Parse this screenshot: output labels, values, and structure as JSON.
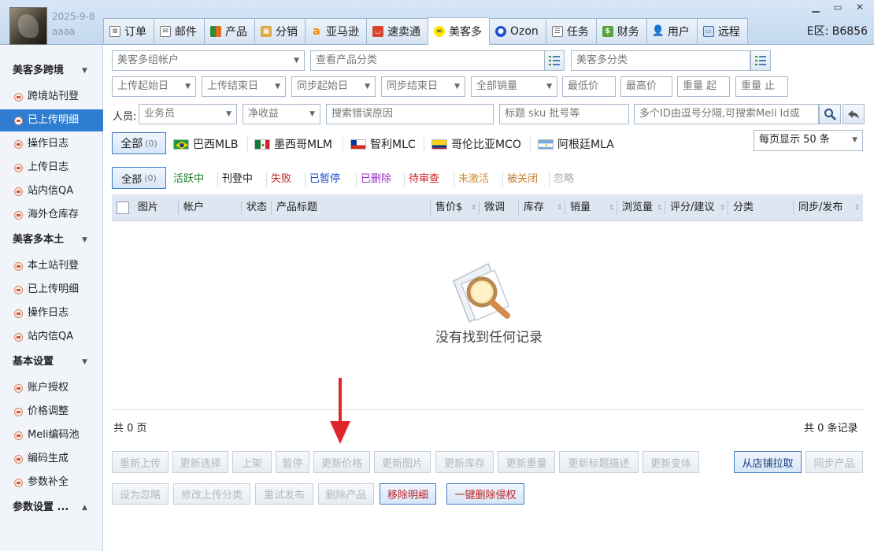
{
  "user": {
    "date": "2025-9-8",
    "name": "aaaa"
  },
  "tabs": [
    {
      "label": "订单",
      "icon": "order-icon"
    },
    {
      "label": "邮件",
      "icon": "mail-icon"
    },
    {
      "label": "产品",
      "icon": "product-icon"
    },
    {
      "label": "分销",
      "icon": "distribution-icon"
    },
    {
      "label": "亚马逊",
      "icon": "amazon-icon"
    },
    {
      "label": "速卖通",
      "icon": "aliexpress-icon"
    },
    {
      "label": "美客多",
      "icon": "mercadolibre-icon",
      "active": true
    },
    {
      "label": "Ozon",
      "icon": "ozon-icon"
    },
    {
      "label": "任务",
      "icon": "task-icon"
    },
    {
      "label": "财务",
      "icon": "finance-icon"
    },
    {
      "label": "用户",
      "icon": "user-icon"
    },
    {
      "label": "远程",
      "icon": "remote-icon"
    }
  ],
  "region": "E区: B6856",
  "sidebar": {
    "groups": [
      {
        "label": "美客多跨境",
        "items": [
          "跨境站刊登",
          "已上传明细",
          "操作日志",
          "上传日志",
          "站内信QA",
          "海外仓库存"
        ]
      },
      {
        "label": "美客多本土",
        "items": [
          "本土站刊登",
          "已上传明细",
          "操作日志",
          "站内信QA"
        ]
      },
      {
        "label": "基本设置",
        "items": [
          "账户授权",
          "价格调整",
          "Meli编码池",
          "编码生成",
          "参数补全"
        ]
      },
      {
        "label": "参数设置 ..."
      }
    ],
    "active_item": "已上传明细"
  },
  "filters": {
    "account_group": "美客多组帐户",
    "product_category": "查看产品分类",
    "meli_category": "美客多分类",
    "upload_start": "上传起始日",
    "upload_end": "上传结束日",
    "sync_start": "同步起始日",
    "sync_end": "同步结束日",
    "sales": "全部销量",
    "min_price": "最低价",
    "max_price": "最高价",
    "weight_from": "重量 起",
    "weight_to": "重量 止",
    "person_label": "人员:",
    "salesman": "业务员",
    "net_income": "净收益",
    "error_reason": "搜索错误原因",
    "title_sku": "标题 sku 批号等",
    "ids": "多个ID由逗号分隔,可搜索Meli Id或"
  },
  "markets": {
    "all": "全部",
    "all_count": "(0)",
    "sites": [
      "巴西MLB",
      "墨西哥MLM",
      "智利MLC",
      "哥伦比亚MCO",
      "阿根廷MLA"
    ],
    "per_page": "每页显示 50 条"
  },
  "status_tabs": {
    "all": "全部",
    "all_count": "(0)",
    "items": [
      {
        "label": "活跃中",
        "color": "#1a7f2a"
      },
      {
        "label": "刊登中",
        "color": "#222222"
      },
      {
        "label": "失败",
        "color": "#c41d1d"
      },
      {
        "label": "已暂停",
        "color": "#1b4fd1"
      },
      {
        "label": "已删除",
        "color": "#9b30c9"
      },
      {
        "label": "待审查",
        "color": "#d01f1f"
      },
      {
        "label": "未激活",
        "color": "#d38c2c"
      },
      {
        "label": "被关闭",
        "color": "#cc7a2d"
      },
      {
        "label": "忽略",
        "color": "#aaaaaa"
      }
    ]
  },
  "table": {
    "columns": [
      "图片",
      "帐户",
      "状态",
      "产品标题",
      "售价$",
      "微调",
      "库存",
      "销量",
      "浏览量",
      "评分/建议",
      "分类",
      "同步/发布"
    ],
    "empty_text": "没有找到任何记录"
  },
  "pagination": {
    "pages": "共 0 页",
    "records": "共 0 条记录"
  },
  "actions_row1": [
    "重新上传",
    "更新选择",
    "上架",
    "暂停",
    "更新价格",
    "更新图片",
    "更新库存",
    "更新重量",
    "更新标题描述",
    "更新变体"
  ],
  "pull_button": "从店铺拉取",
  "sync_button": "同步产品",
  "actions_row2": [
    "设为忽略",
    "修改上传分类",
    "重试发布",
    "删除产品"
  ],
  "remove_detail": "移除明细",
  "delete_infringing": "一键删除侵权"
}
